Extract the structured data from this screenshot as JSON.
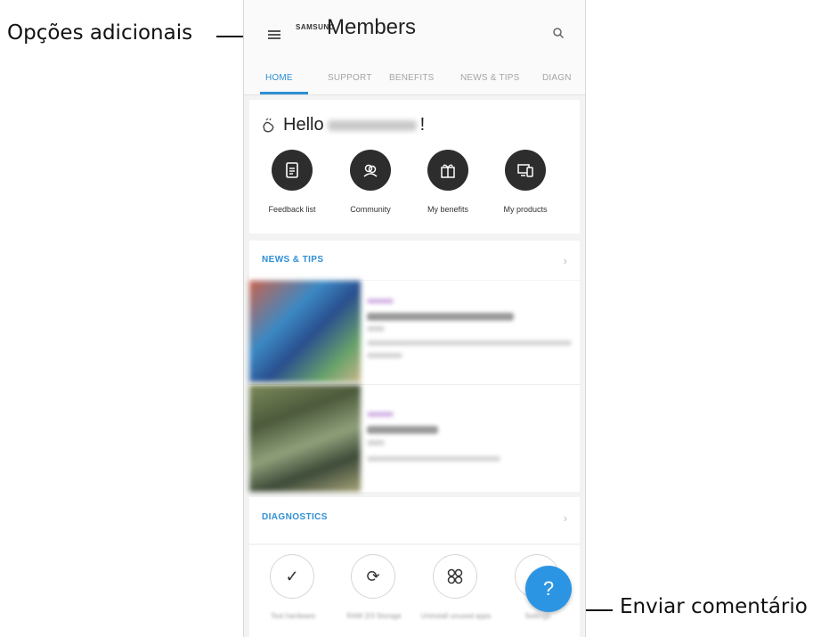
{
  "callouts": {
    "left": "Opções adicionais",
    "right": "Enviar comentário"
  },
  "app": {
    "brand": "SAMSUNG",
    "name": "Members"
  },
  "tabs": [
    {
      "label": "HOME",
      "active": true
    },
    {
      "label": "SUPPORT"
    },
    {
      "label": "BENEFITS"
    },
    {
      "label": "NEWS & TIPS"
    },
    {
      "label": "DIAGN"
    }
  ],
  "greeting": {
    "prefix": "Hello",
    "suffix": "!"
  },
  "quick_actions": [
    {
      "label": "Feedback list",
      "icon": "feedback-list-icon"
    },
    {
      "label": "Community",
      "icon": "community-icon"
    },
    {
      "label": "My benefits",
      "icon": "gift-icon"
    },
    {
      "label": "My products",
      "icon": "devices-icon"
    }
  ],
  "sections": {
    "news": "NEWS & TIPS",
    "diagnostics": "DIAGNOSTICS"
  },
  "fab": {
    "label": "?"
  },
  "colors": {
    "accent": "#2e8fd3",
    "fab": "#2b95e3",
    "icon_circle": "#2d2d2d"
  }
}
